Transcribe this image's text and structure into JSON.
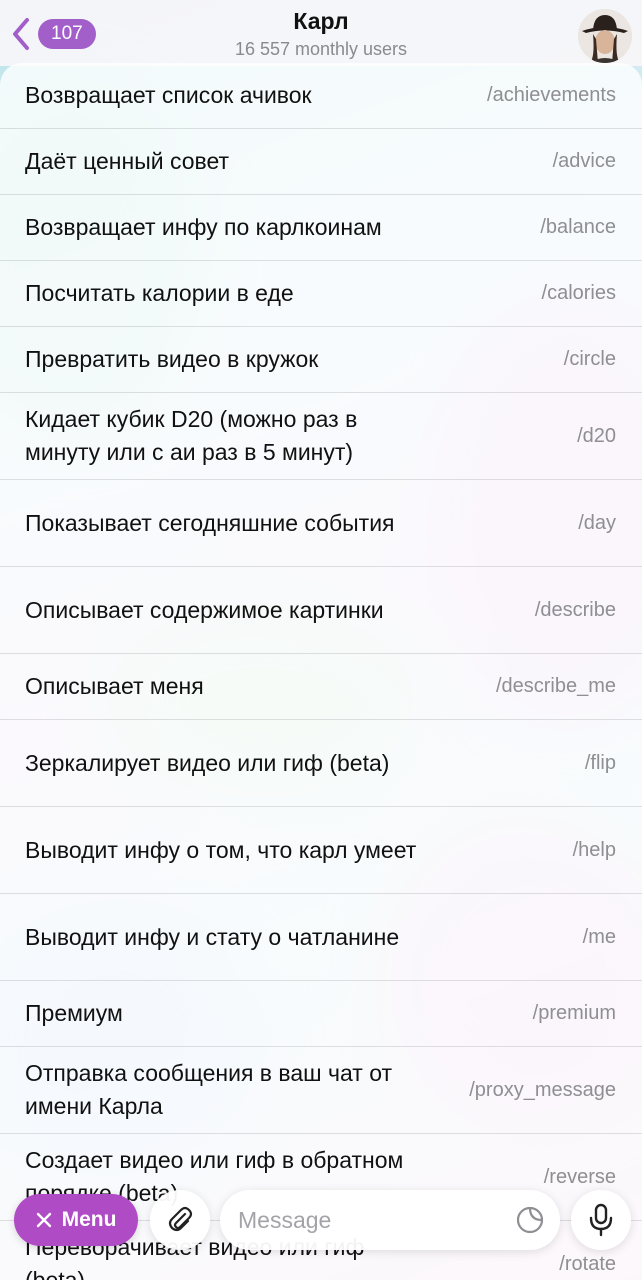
{
  "header": {
    "back_count": "107",
    "title": "Карл",
    "subtitle": "16 557 monthly users"
  },
  "commands": [
    {
      "desc": "Возвращает список ачивок",
      "cmd": "/achievements"
    },
    {
      "desc": "Даёт ценный совет",
      "cmd": "/advice"
    },
    {
      "desc": "Возвращает инфу по карлкоинам",
      "cmd": "/balance"
    },
    {
      "desc": "Посчитать калории в еде",
      "cmd": "/calories"
    },
    {
      "desc": "Превратить видео в кружок",
      "cmd": "/circle"
    },
    {
      "desc": "Кидает кубик D20 (можно раз в минуту или с аи раз в 5 минут)",
      "cmd": "/d20"
    },
    {
      "desc": "Показывает сегодняшние события",
      "cmd": "/day"
    },
    {
      "desc": "Описывает содержимое картинки",
      "cmd": "/describe"
    },
    {
      "desc": "Описывает меня",
      "cmd": "/describe_me"
    },
    {
      "desc": "Зеркалирует видео или гиф (beta)",
      "cmd": "/flip"
    },
    {
      "desc": "Выводит инфу о том, что карл умеет",
      "cmd": "/help"
    },
    {
      "desc": "Выводит инфу и стату о чатланине",
      "cmd": "/me"
    },
    {
      "desc": "Премиум",
      "cmd": "/premium"
    },
    {
      "desc": "Отправка сообщения в ваш чат от имени Карла",
      "cmd": "/proxy_message"
    },
    {
      "desc": "Создает видео или гиф в обратном порядке (beta)",
      "cmd": "/reverse"
    },
    {
      "desc": "Переворачивает видео или гиф (beta)",
      "cmd": "/rotate"
    }
  ],
  "inputbar": {
    "menu_label": "Menu",
    "message_placeholder": "Message"
  },
  "colors": {
    "accent": "#a25ec9",
    "menu_button": "#b04bc6"
  },
  "icons": [
    "chevron-left-icon",
    "close-icon",
    "paperclip-icon",
    "sticker-icon",
    "microphone-icon"
  ]
}
